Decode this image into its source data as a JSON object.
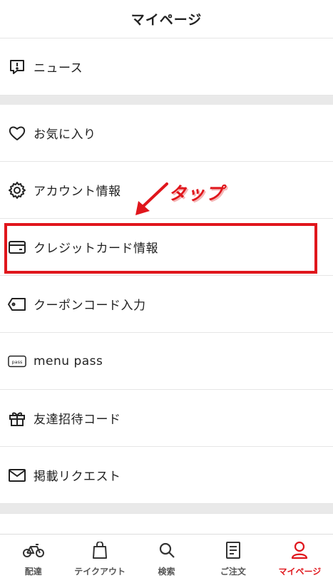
{
  "header": {
    "title": "マイページ"
  },
  "menu": {
    "news": {
      "label": "ニュース",
      "icon": "news-exclaim-icon"
    },
    "items": [
      {
        "label": "お気に入り",
        "icon": "heart-icon"
      },
      {
        "label": "アカウント情報",
        "icon": "gear-icon"
      },
      {
        "label": "クレジットカード情報",
        "icon": "credit-card-icon"
      },
      {
        "label": "クーポンコード入力",
        "icon": "coupon-tag-icon"
      },
      {
        "label": "menu pass",
        "icon": "pass-icon"
      },
      {
        "label": "友達招待コード",
        "icon": "gift-icon"
      },
      {
        "label": "掲載リクエスト",
        "icon": "mail-icon"
      }
    ]
  },
  "annotation": {
    "text": "タップ",
    "color": "#e0161c"
  },
  "tabbar": {
    "tabs": [
      {
        "label": "配達",
        "icon": "bicycle-icon",
        "active": false
      },
      {
        "label": "テイクアウト",
        "icon": "shopping-bag-icon",
        "active": false
      },
      {
        "label": "検索",
        "icon": "search-icon",
        "active": false
      },
      {
        "label": "ご注文",
        "icon": "order-list-icon",
        "active": false
      },
      {
        "label": "マイページ",
        "icon": "user-icon",
        "active": true
      }
    ],
    "active_color": "#e0161c"
  }
}
